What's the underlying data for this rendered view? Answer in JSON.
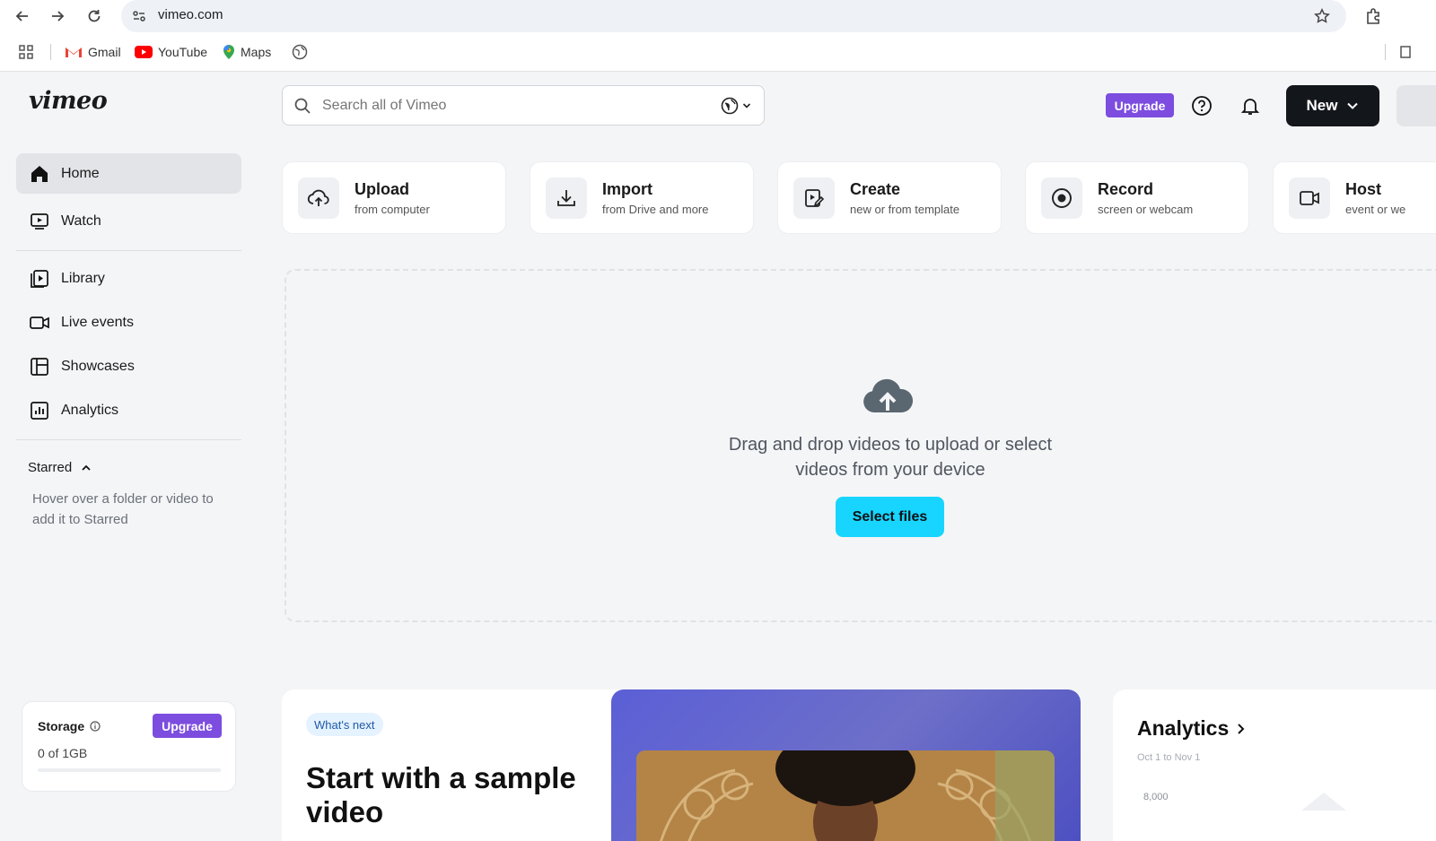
{
  "browser": {
    "url": "vimeo.com",
    "bookmarks": [
      {
        "label": "Gmail",
        "icon": "gmail-icon"
      },
      {
        "label": "YouTube",
        "icon": "youtube-icon"
      },
      {
        "label": "Maps",
        "icon": "maps-icon"
      }
    ]
  },
  "header": {
    "logo": "vimeo",
    "search_placeholder": "Search all of Vimeo",
    "upgrade_label": "Upgrade",
    "new_label": "New"
  },
  "sidebar": {
    "primary": [
      {
        "label": "Home",
        "icon": "home-icon",
        "active": true
      },
      {
        "label": "Watch",
        "icon": "watch-icon"
      }
    ],
    "secondary": [
      {
        "label": "Library",
        "icon": "library-icon"
      },
      {
        "label": "Live events",
        "icon": "live-events-icon"
      },
      {
        "label": "Showcases",
        "icon": "showcases-icon"
      },
      {
        "label": "Analytics",
        "icon": "analytics-icon"
      }
    ],
    "starred": {
      "heading": "Starred",
      "hint": "Hover over a folder or video to add it to Starred"
    },
    "storage": {
      "label": "Storage",
      "upgrade_label": "Upgrade",
      "value": "0 of 1GB",
      "used_fraction": 0
    }
  },
  "actions": [
    {
      "title": "Upload",
      "subtitle": "from computer",
      "icon": "upload-cloud-icon"
    },
    {
      "title": "Import",
      "subtitle": "from Drive and more",
      "icon": "download-icon"
    },
    {
      "title": "Create",
      "subtitle": "new or from template",
      "icon": "create-edit-icon"
    },
    {
      "title": "Record",
      "subtitle": "screen or webcam",
      "icon": "record-icon"
    },
    {
      "title": "Host",
      "subtitle": "event or we",
      "icon": "host-video-icon"
    }
  ],
  "dropzone": {
    "text": "Drag and drop videos to upload or select videos from your device",
    "button": "Select files"
  },
  "whats_next": {
    "badge": "What's next",
    "title": "Start with a sample video"
  },
  "analytics_card": {
    "title": "Analytics",
    "date_range": "Oct 1 to Nov 1",
    "y_tick": "8,000"
  },
  "colors": {
    "accent_purple": "#7c4ddf",
    "select_button": "#17d5ff",
    "new_button": "#13161b"
  }
}
